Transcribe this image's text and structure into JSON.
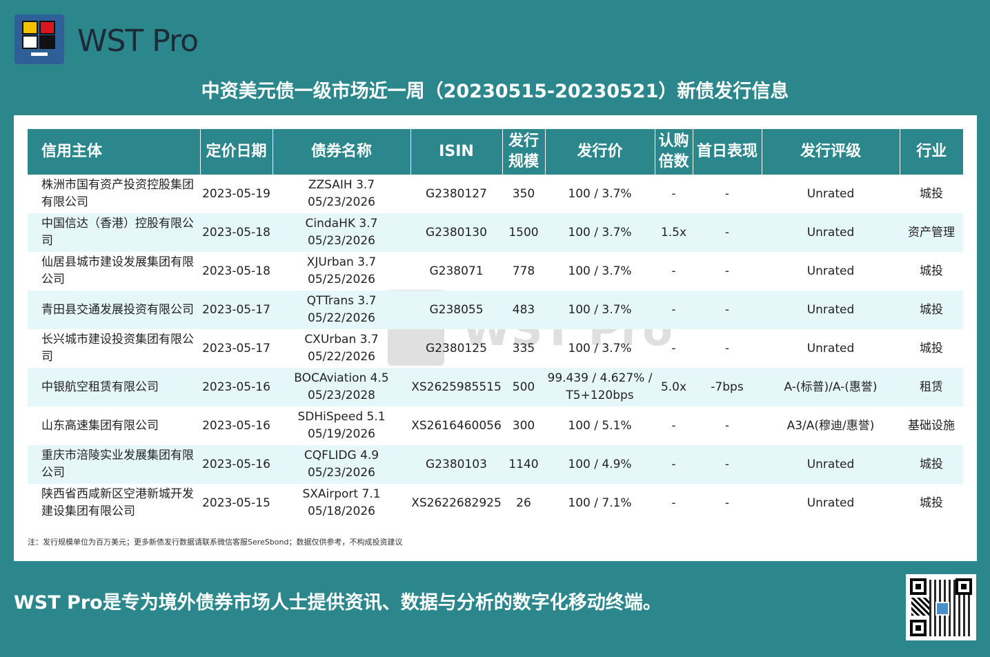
{
  "brand": {
    "name": "WST Pro",
    "accent": "#2b878c",
    "logo_icon": "wst-logo-icon"
  },
  "title": "中资美元债一级市场近一周（20230515-20230521）新债发行信息",
  "table": {
    "headers": [
      "信用主体",
      "定价日期",
      "债券名称",
      "ISIN",
      "发行规模",
      "发行价",
      "认购倍数",
      "首日表现",
      "发行评级",
      "行业"
    ],
    "rows": [
      {
        "issuer": "株洲市国有资产投资控股集团有限公司",
        "date": "2023-05-19",
        "bond_line1": "ZZSAIH 3.7",
        "bond_line2": "05/23/2026",
        "isin": "G2380127",
        "size": "350",
        "price": "100 / 3.7%",
        "cover": "-",
        "first_day": "-",
        "rating": "Unrated",
        "industry": "城投"
      },
      {
        "issuer": "中国信达（香港）控股有限公司",
        "date": "2023-05-18",
        "bond_line1": "CindaHK 3.7",
        "bond_line2": "05/23/2026",
        "isin": "G2380130",
        "size": "1500",
        "price": "100 / 3.7%",
        "cover": "1.5x",
        "first_day": "-",
        "rating": "Unrated",
        "industry": "资产管理"
      },
      {
        "issuer": "仙居县城市建设发展集团有限公司",
        "date": "2023-05-18",
        "bond_line1": "XJUrban 3.7",
        "bond_line2": "05/25/2026",
        "isin": "G238071",
        "size": "778",
        "price": "100 / 3.7%",
        "cover": "-",
        "first_day": "-",
        "rating": "Unrated",
        "industry": "城投"
      },
      {
        "issuer": "青田县交通发展投资有限公司",
        "date": "2023-05-17",
        "bond_line1": "QTTrans 3.7",
        "bond_line2": "05/22/2026",
        "isin": "G238055",
        "size": "483",
        "price": "100 / 3.7%",
        "cover": "-",
        "first_day": "-",
        "rating": "Unrated",
        "industry": "城投"
      },
      {
        "issuer": "长兴城市建设投资集团有限公司",
        "date": "2023-05-17",
        "bond_line1": "CXUrban 3.7",
        "bond_line2": "05/22/2026",
        "isin": "G2380125",
        "size": "335",
        "price": "100 / 3.7%",
        "cover": "-",
        "first_day": "-",
        "rating": "Unrated",
        "industry": "城投"
      },
      {
        "issuer": "中银航空租赁有限公司",
        "date": "2023-05-16",
        "bond_line1": "BOCAviation 4.5",
        "bond_line2": "05/23/2028",
        "isin": "XS2625985515",
        "size": "500",
        "price": "99.439 / 4.627% / T5+120bps",
        "cover": "5.0x",
        "first_day": "-7bps",
        "rating": "A-(标普)/A-(惠誉)",
        "industry": "租赁"
      },
      {
        "issuer": "山东高速集团有限公司",
        "date": "2023-05-16",
        "bond_line1": "SDHiSpeed 5.1",
        "bond_line2": "05/19/2026",
        "isin": "XS2616460056",
        "size": "300",
        "price": "100 / 5.1%",
        "cover": "-",
        "first_day": "-",
        "rating": "A3/A(穆迪/惠誉)",
        "industry": "基础设施"
      },
      {
        "issuer": "重庆市涪陵实业发展集团有限公司",
        "date": "2023-05-16",
        "bond_line1": "CQFLIDG 4.9",
        "bond_line2": "05/23/2026",
        "isin": "G2380103",
        "size": "1140",
        "price": "100 / 4.9%",
        "cover": "-",
        "first_day": "-",
        "rating": "Unrated",
        "industry": "城投"
      },
      {
        "issuer": "陕西省西咸新区空港新城开发建设集团有限公司",
        "date": "2023-05-15",
        "bond_line1": "SXAirport 7.1",
        "bond_line2": "05/18/2026",
        "isin": "XS2622682925",
        "size": "26",
        "price": "100 / 7.1%",
        "cover": "-",
        "first_day": "-",
        "rating": "Unrated",
        "industry": "城投"
      }
    ]
  },
  "note": "注：发行规模单位为百万美元；更多新债发行数据请联系微信客服SereSbond；数据仅供参考，不构成投资建议",
  "footer": {
    "tagline": "WST Pro是专为境外债券市场人士提供资讯、数据与分析的数字化移动终端。",
    "qr_icon": "qr-code-icon"
  }
}
